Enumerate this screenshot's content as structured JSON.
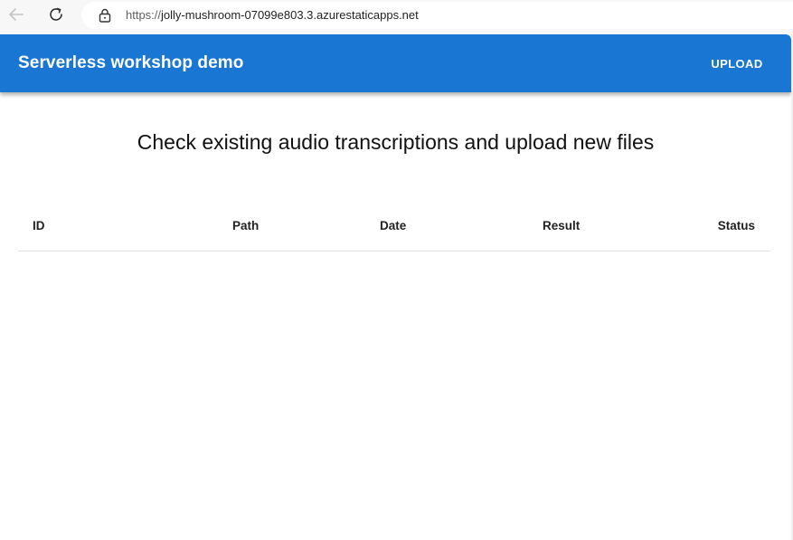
{
  "browser": {
    "url_scheme": "https://",
    "url_host": "jolly-mushroom-07099e803.3.azurestaticapps.net"
  },
  "app": {
    "title": "Serverless workshop demo",
    "upload_label": "UPLOAD",
    "accent_color": "#1976d2"
  },
  "main": {
    "heading": "Check existing audio transcriptions and upload new files"
  },
  "table": {
    "columns": [
      "ID",
      "Path",
      "Date",
      "Result",
      "Status"
    ],
    "rows": []
  }
}
